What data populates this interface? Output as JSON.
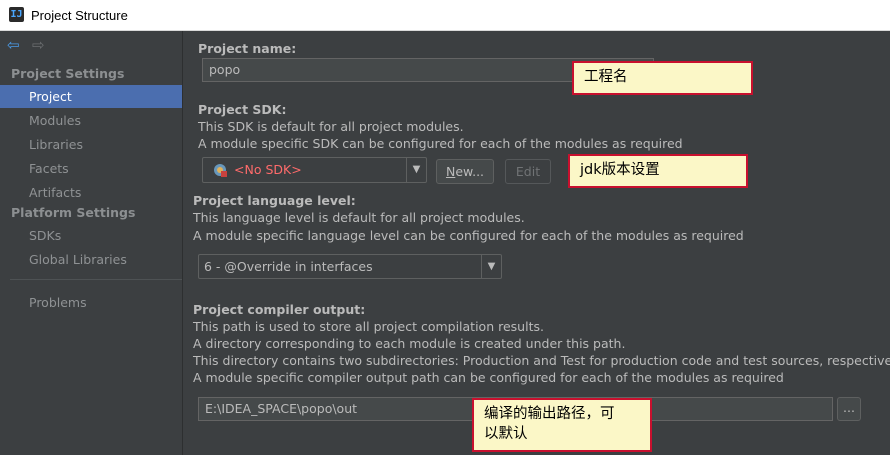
{
  "window": {
    "title": "Project Structure",
    "app_icon": "intellij-icon",
    "app_icon_glyph": "IJ"
  },
  "nav": {
    "back_icon": "back-arrow-icon",
    "forward_icon": "forward-arrow-icon",
    "back_glyph": "⇦",
    "forward_glyph": "⇨"
  },
  "sidebar": {
    "project_settings_header": "Project Settings",
    "project_settings_items": [
      {
        "label": "Project",
        "selected": true
      },
      {
        "label": "Modules"
      },
      {
        "label": "Libraries"
      },
      {
        "label": "Facets"
      },
      {
        "label": "Artifacts"
      }
    ],
    "platform_settings_header": "Platform Settings",
    "platform_settings_items": [
      {
        "label": "SDKs"
      },
      {
        "label": "Global Libraries"
      }
    ],
    "problems_label": "Problems"
  },
  "project_name": {
    "label": "Project name:",
    "value": "popo",
    "annotation": "工程名"
  },
  "project_sdk": {
    "label": "Project SDK:",
    "desc1": "This SDK is default for all project modules.",
    "desc2": "A module specific SDK can be configured for each of the modules as required",
    "selected": "<No SDK>",
    "new_button_prefix": "N",
    "new_button_rest": "ew...",
    "edit_button": "Edit",
    "annotation": "jdk版本设置"
  },
  "language_level": {
    "label": "Project language level:",
    "desc1": "This language level is default for all project modules.",
    "desc2": "A module specific language level can be configured for each of the modules as required",
    "selected": "6 - @Override in interfaces"
  },
  "compiler_output": {
    "label": "Project compiler output:",
    "desc1": "This path is used to store all project compilation results.",
    "desc2": "A directory corresponding to each module is created under this path.",
    "desc3": "This directory contains two subdirectories: Production and Test for production code and test sources, respectively.",
    "desc4": "A module specific compiler output path can be configured for each of the modules as required",
    "value": "E:\\IDEA_SPACE\\popo\\out",
    "browse_button": "...",
    "annotation_line1": "编译的输出路径，可",
    "annotation_line2": "以默认"
  },
  "colors": {
    "background": "#3c3f41",
    "selection": "#4b6eaf",
    "annotation_bg": "#fbf7c7",
    "annotation_border": "#c8102e",
    "no_sdk_text": "#ff6b6b"
  }
}
